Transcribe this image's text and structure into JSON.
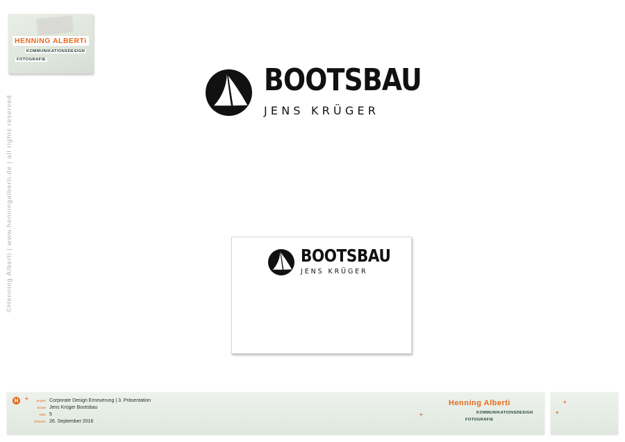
{
  "note": {
    "name": "HENNiNG ALBERTi",
    "line1": "KOMMUNIKATIONSDESIGN",
    "line2": "FOTOGRAFIE"
  },
  "copyright": "©Henning Alberti | www.henningalberti.de | all rights reserved",
  "logo": {
    "wordmark": "BOOTSBAU",
    "subline": "JENS KRÜGER",
    "icon": "sailboat-circle-icon"
  },
  "footer": {
    "rows": [
      {
        "key": "projekt",
        "value": "Corporate Design Erneuerung  |  3. Präsentation"
      },
      {
        "key": "kunde",
        "value": "Jens Krüger Bootsbau"
      },
      {
        "key": "seite",
        "value": "5"
      },
      {
        "key": "zeitraum",
        "value": "26. September 2016"
      }
    ],
    "brand_name": "Henning Alberti",
    "brand_line1": "KOMMUNIKATIONSDESIGN",
    "brand_line2": "FOTOGRAFIE",
    "badge_letter": "H"
  },
  "colors": {
    "accent": "#e8671a",
    "ink": "#111111",
    "note_bg": "#e3e9e0"
  }
}
